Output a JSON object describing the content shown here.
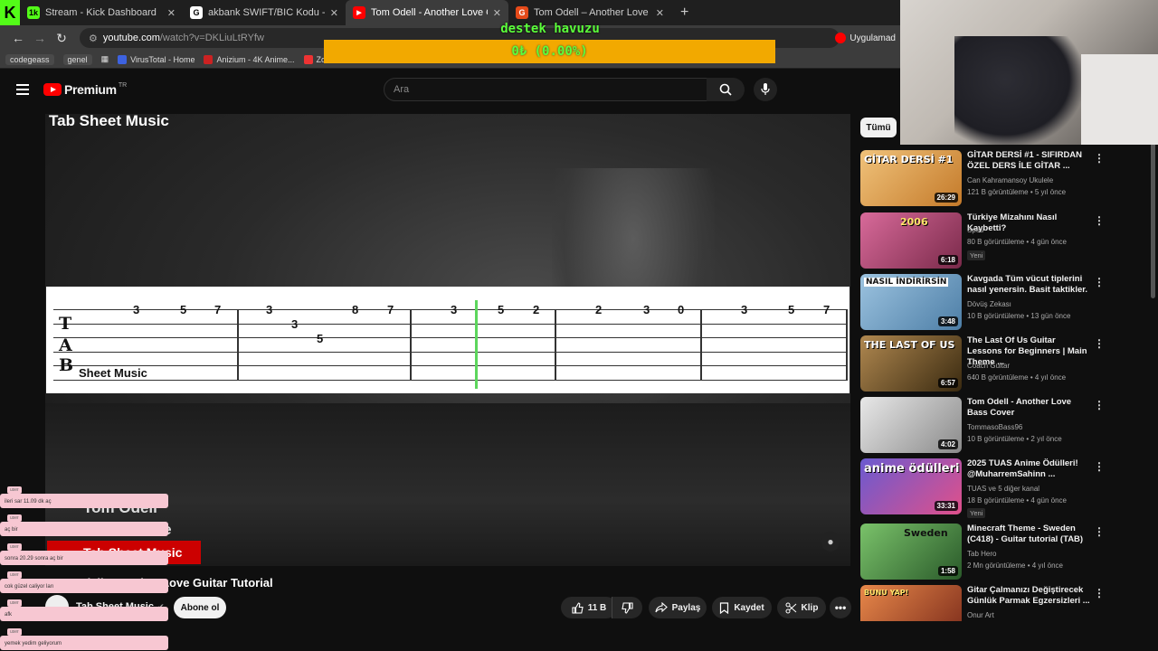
{
  "browser": {
    "tabs": [
      {
        "title": "Stream - Kick Dashboard",
        "fav_color": "#53fc18",
        "fav_text": "1k"
      },
      {
        "title": "akbank SWIFT/BIC Kodu - Goog",
        "fav_color": "#ffffff",
        "fav_text": "G"
      },
      {
        "title": "Tom Odell - Another Love Guita",
        "fav_color": "#ff0000",
        "fav_text": "▶"
      },
      {
        "title": "Tom Odell – Another Love – Git",
        "fav_color": "#e64a19",
        "fav_text": "G"
      }
    ],
    "url_site": "youtube.com",
    "url_path": "/watch?v=DKLiuLtRYfw",
    "yt_app_label": "Uygulamad",
    "bookmarks": [
      {
        "label": "codegeass",
        "chip": true
      },
      {
        "label": "genel",
        "chip": true
      },
      {
        "label": "VirusTotal - Home",
        "color": "#3d62e0"
      },
      {
        "label": "Anizium - 4K Anime...",
        "color": "#c22"
      },
      {
        "label": "Zoho Sh",
        "color": "#e33"
      }
    ]
  },
  "overlay": {
    "destek_title": "destek havuzu",
    "destek_value": "0₺ (0.00%)"
  },
  "youtube": {
    "logo_text": "Premium",
    "logo_region": "TR",
    "search_placeholder": "Ara",
    "channel_watermark": "Tab Sheet Music",
    "tab_sheet_label": "Sheet Music",
    "tab_numbers": {
      "row1": [
        "3",
        "5",
        "7",
        "3",
        "8",
        "7",
        "3",
        "5",
        "2",
        "2",
        "3",
        "0",
        "3",
        "5",
        "7"
      ],
      "row2": [
        "3"
      ],
      "row3": [
        "5"
      ]
    },
    "end_card": "Tab Sheet Music",
    "end_title_1": "Tom Odell",
    "end_title_2": "Another Love",
    "video_title": "Tom Odell - Another Love Guitar Tutorial",
    "channel_name": "Tab Sheet Music",
    "subscribe_label": "Abone ol",
    "actions": {
      "like_count": "11 B",
      "share": "Paylaş",
      "save": "Kaydet",
      "clip": "Klip"
    },
    "filter_chip": "Tümü",
    "recommendations": [
      {
        "title": "GİTAR DERSİ #1 - SIFIRDAN ÖZEL DERS İLE GİTAR ...",
        "channel": "Can Kahramansoy Ukulele",
        "stats": "121 B görüntüleme • 5 yıl önce",
        "duration": "26:29",
        "thumb_text": "GİTAR DERSİ #1",
        "thumb_bg": "#e8a24a",
        "new": ""
      },
      {
        "title": "Türkiye Mizahını Nasıl Kaybetti?",
        "channel": "Spes",
        "stats": "80 B görüntüleme • 4 gün önce",
        "duration": "6:18",
        "thumb_text": "2006",
        "thumb_bg": "#b44b7a",
        "new": "Yeni"
      },
      {
        "title": "Kavgada Tüm vücut tiplerini nasıl yenersin. Basit taktikler.",
        "channel": "Dövüş Zekası",
        "stats": "10 B görüntüleme • 13 gün önce",
        "duration": "3:48",
        "thumb_text": "NASIL İNDİRİRSİN",
        "thumb_bg": "#6b93b8",
        "new": ""
      },
      {
        "title": "The Last Of Us Guitar Lessons for Beginners | Main Theme ...",
        "channel": "Coach Guitar",
        "stats": "640 B görüntüleme • 4 yıl önce",
        "duration": "6:57",
        "thumb_text": "THE LAST OF US",
        "thumb_bg": "#7a5a2a",
        "new": ""
      },
      {
        "title": "Tom Odell - Another Love Bass Cover",
        "channel": "TommasoBass96",
        "stats": "10 B görüntüleme • 2 yıl önce",
        "duration": "4:02",
        "thumb_text": "",
        "thumb_bg": "#cfcfcf",
        "new": ""
      },
      {
        "title": "2025 TUAS Anime Ödülleri! @MuharremSahinn ...",
        "channel": "TUAS ve 5 diğer kanal",
        "stats": "18 B görüntüleme • 4 gün önce",
        "duration": "33:31",
        "thumb_text": "anime ödülleri",
        "thumb_bg": "#4a3aa0",
        "new": "Yeni"
      },
      {
        "title": "Minecraft Theme - Sweden (C418) - Guitar tutorial (TAB)",
        "channel": "Tab Hero",
        "stats": "2 Mn görüntüleme • 4 yıl önce",
        "duration": "1:58",
        "thumb_text": "Sweden",
        "thumb_bg": "#3a7a3a",
        "new": ""
      },
      {
        "title": "Gitar Çalmanızı Değiştirecek Günlük Parmak Egzersizleri ...",
        "channel": "Onur Art",
        "stats": "",
        "duration": "",
        "thumb_text": "BUNU YAP!",
        "thumb_bg": "#d65a2a",
        "new": ""
      }
    ]
  },
  "chat": [
    "ileri sar 11.09 dk aç",
    "aç bir",
    "sonra 20.29 sonra aç bir",
    "cok güzel caliyor ları",
    "afk",
    "yemek yedim geliyorum"
  ]
}
